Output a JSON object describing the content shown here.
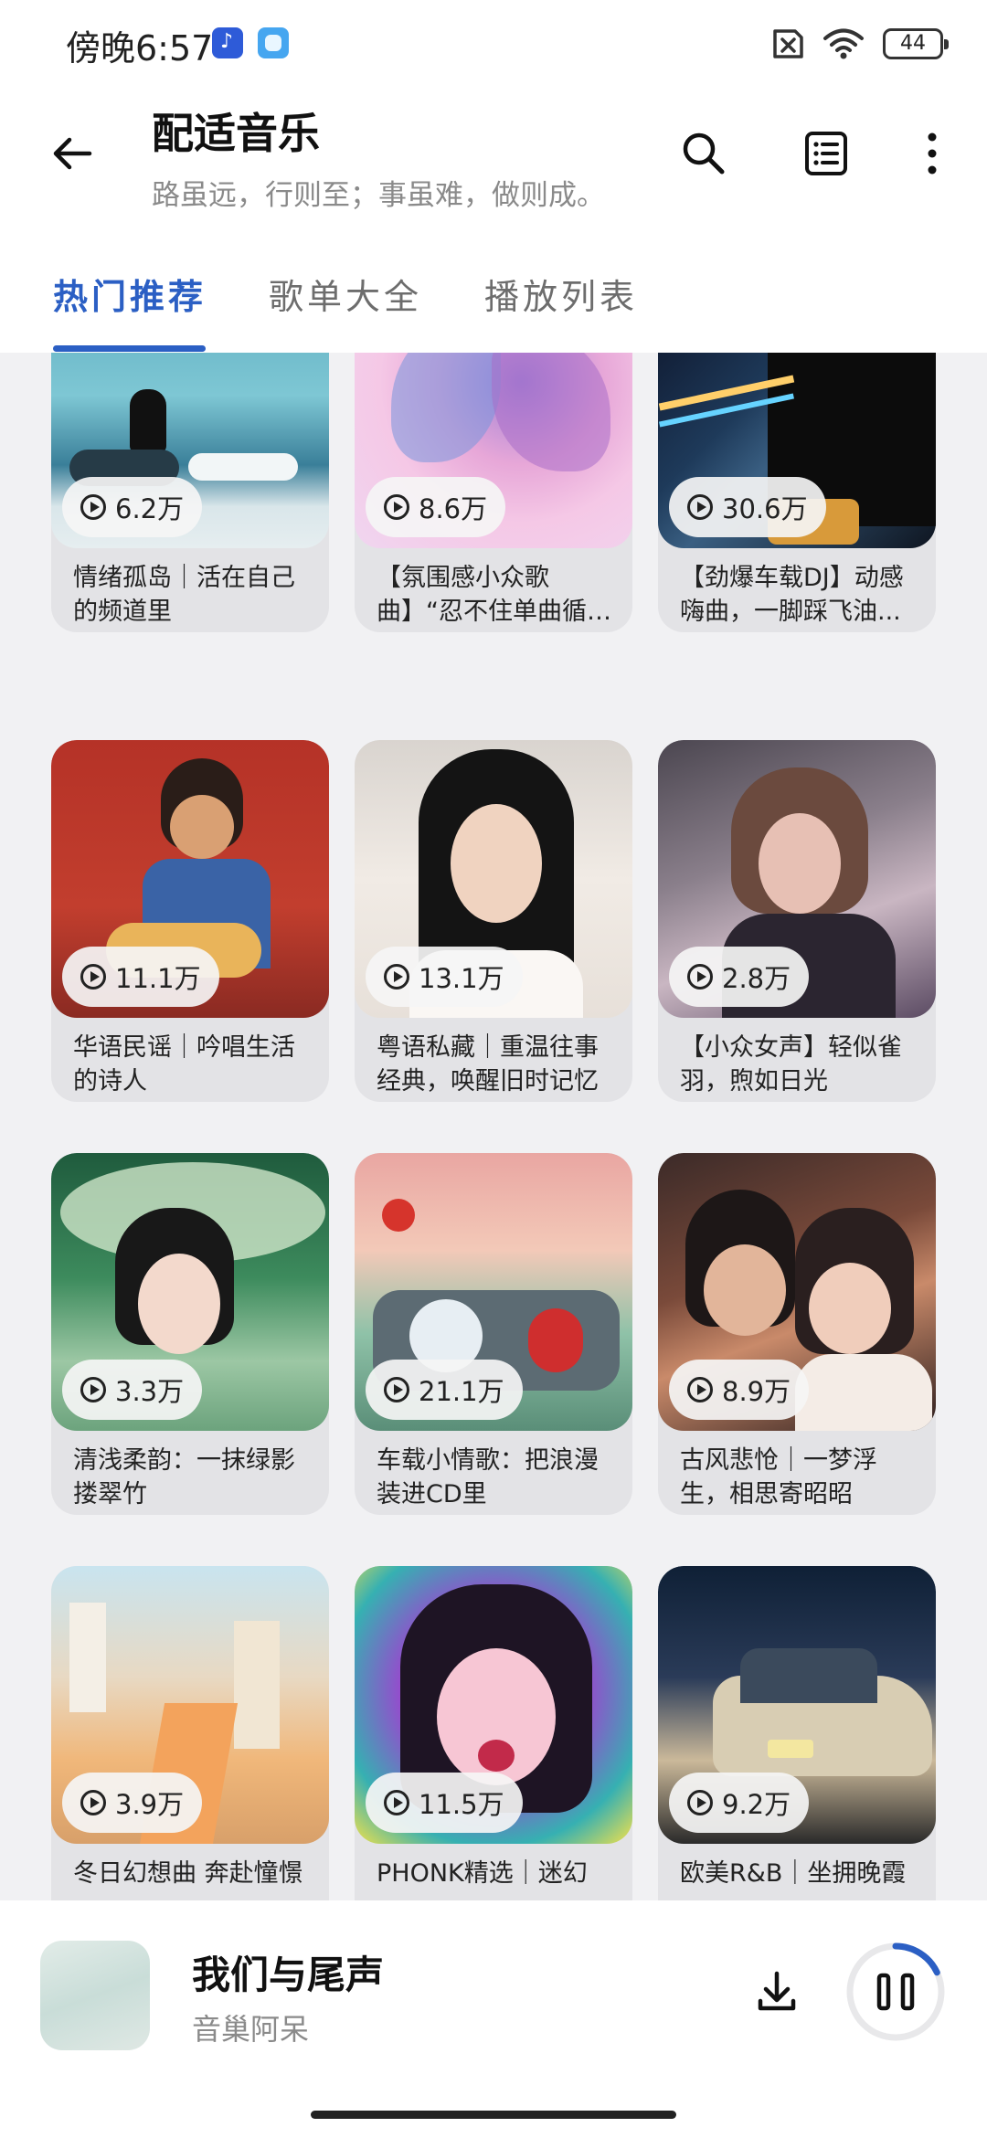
{
  "status_bar": {
    "time": "傍晚6:57",
    "battery": "44"
  },
  "header": {
    "title": "配适音乐",
    "subtitle": "路虽远，行则至；事虽难，做则成。"
  },
  "tabs": [
    {
      "label": "热门推荐"
    },
    {
      "label": "歌单大全"
    },
    {
      "label": "播放列表"
    }
  ],
  "playlists": [
    {
      "plays": "6.2万",
      "title": "情绪孤岛｜活在自己的频道里"
    },
    {
      "plays": "8.6万",
      "title": "【氛围感小众歌曲】“忍不住单曲循环！”"
    },
    {
      "plays": "30.6万",
      "title": "【劲爆车载DJ】动感嗨曲，一脚踩飞油..."
    },
    {
      "plays": "11.1万",
      "title": "华语民谣｜吟唱生活的诗人"
    },
    {
      "plays": "13.1万",
      "title": "粤语私藏｜重温往事经典，唤醒旧时记忆"
    },
    {
      "plays": "2.8万",
      "title": "【小众女声】轻似雀羽，煦如日光"
    },
    {
      "plays": "3.3万",
      "title": "清浅柔韵：一抹绿影搂翠竹"
    },
    {
      "plays": "21.1万",
      "title": "车载小情歌：把浪漫装进CD里"
    },
    {
      "plays": "8.9万",
      "title": "古风悲怆｜一梦浮生，相思寄昭昭"
    },
    {
      "plays": "3.9万",
      "title": "冬日幻想曲 奔赴憧憬"
    },
    {
      "plays": "11.5万",
      "title": "PHONK精选｜迷幻"
    },
    {
      "plays": "9.2万",
      "title": "欧美R&B｜坐拥晚霞"
    }
  ],
  "player": {
    "song": "我们与尾声",
    "artist": "音巢阿呆",
    "progress": 0.18,
    "accent": "#2b5fc4"
  }
}
